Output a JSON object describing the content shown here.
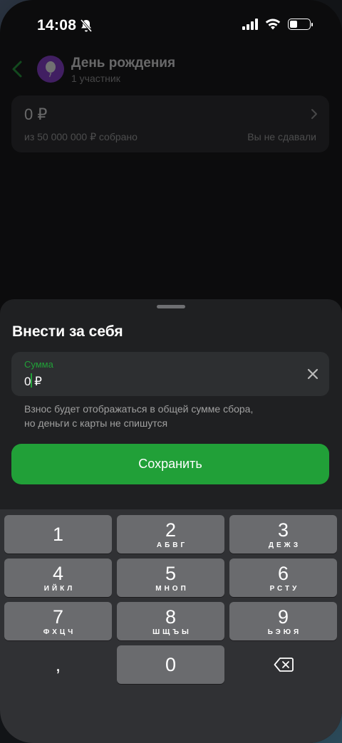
{
  "status_bar": {
    "time": "14:08",
    "icons": [
      "bell-off-icon",
      "signal-icon",
      "wifi-icon",
      "battery-icon"
    ],
    "battery_level": 0.4
  },
  "background_page": {
    "title": "День рождения",
    "subtitle": "1 участник",
    "collected": "0 ₽",
    "progress_text": "из 50 000 000 ₽ собрано",
    "status_text": "Вы не сдавали",
    "avatar_color": "#8e3cd8"
  },
  "sheet": {
    "title": "Внести за себя",
    "amount_label": "Сумма",
    "amount_value": "0 ₽",
    "hint_line1": "Взнос будет отображаться в общей сумме сбора,",
    "hint_line2": "но деньги с карты не спишутся",
    "save_label": "Сохранить"
  },
  "keyboard": {
    "keys": [
      {
        "digit": "1",
        "letters": ""
      },
      {
        "digit": "2",
        "letters": "АБВГ"
      },
      {
        "digit": "3",
        "letters": "ДЕЖЗ"
      },
      {
        "digit": "4",
        "letters": "ИЙКЛ"
      },
      {
        "digit": "5",
        "letters": "МНОП"
      },
      {
        "digit": "6",
        "letters": "РСТУ"
      },
      {
        "digit": "7",
        "letters": "ФХЦЧ"
      },
      {
        "digit": "8",
        "letters": "ШЩЪЫ"
      },
      {
        "digit": "9",
        "letters": "ЬЭЮЯ"
      },
      {
        "digit": "0",
        "letters": ""
      }
    ],
    "comma": ","
  },
  "colors": {
    "accent": "#21a038",
    "sheet": "#1f2022",
    "key": "#6a6b6e"
  }
}
